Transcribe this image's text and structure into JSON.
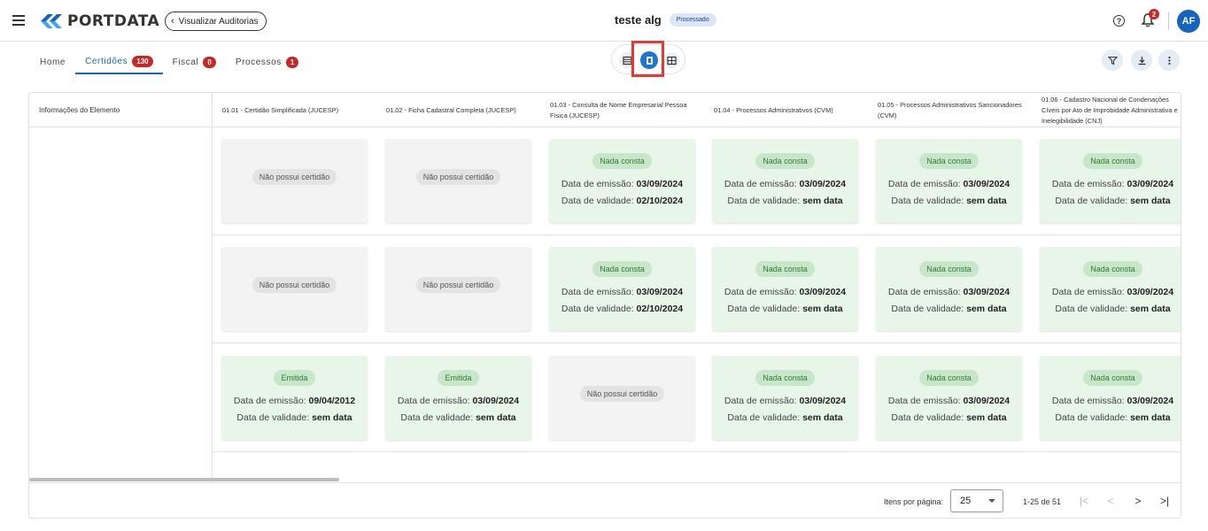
{
  "header": {
    "brand": "PORTDATA",
    "back_label": "Visualizar Auditorias",
    "title": "teste alg",
    "status": "Processado",
    "notif_count": "2",
    "avatar": "AF",
    "help": "?"
  },
  "tabs": [
    {
      "label": "Home",
      "count": null,
      "active": false
    },
    {
      "label": "Certidões",
      "count": "130",
      "active": true
    },
    {
      "label": "Fiscal",
      "count": "0",
      "active": false
    },
    {
      "label": "Processos",
      "count": "1",
      "active": false
    }
  ],
  "view_toggle": {
    "icons": [
      "list-view-icon",
      "card-view-icon",
      "table-view-icon"
    ],
    "active_index": 1
  },
  "actions": [
    "filter-icon",
    "download-icon",
    "more-vert-icon"
  ],
  "table": {
    "left_header": "Informações do Elemento",
    "columns": [
      "01.01 - Certidão Simplificada (JUCESP)",
      "01.02 - Ficha Cadastral Completa (JUCESP)",
      "01.03 - Consulta de Nome Empresarial Pessoa Física (JUCESP)",
      "01.04 - Processos Administrativos (CVM)",
      "01.05 - Processos Administrativos Sancionadores (CVM)",
      "01.06 - Cadastro Nacional de Condenações Cíveis por Ato de Improbidade Administrativa e Inelegibilidade (CNJ)"
    ],
    "labels": {
      "issue": "Data de emissão:",
      "valid": "Data de validade:"
    },
    "rows": [
      [
        {
          "status": "Não possui certidão",
          "type": "none"
        },
        {
          "status": "Não possui certidão",
          "type": "none"
        },
        {
          "status": "Nada consta",
          "type": "ok",
          "issue": "03/09/2024",
          "valid": "02/10/2024"
        },
        {
          "status": "Nada consta",
          "type": "ok",
          "issue": "03/09/2024",
          "valid": "sem data"
        },
        {
          "status": "Nada consta",
          "type": "ok",
          "issue": "03/09/2024",
          "valid": "sem data"
        },
        {
          "status": "Nada consta",
          "type": "ok",
          "issue": "03/09/2024",
          "valid": "sem data"
        }
      ],
      [
        {
          "status": "Não possui certidão",
          "type": "none"
        },
        {
          "status": "Não possui certidão",
          "type": "none"
        },
        {
          "status": "Nada consta",
          "type": "ok",
          "issue": "03/09/2024",
          "valid": "02/10/2024"
        },
        {
          "status": "Nada consta",
          "type": "ok",
          "issue": "03/09/2024",
          "valid": "sem data"
        },
        {
          "status": "Nada consta",
          "type": "ok",
          "issue": "03/09/2024",
          "valid": "sem data"
        },
        {
          "status": "Nada consta",
          "type": "ok",
          "issue": "03/09/2024",
          "valid": "sem data"
        }
      ],
      [
        {
          "status": "Emitida",
          "type": "ok",
          "issue": "09/04/2012",
          "valid": "sem data"
        },
        {
          "status": "Emitida",
          "type": "ok",
          "issue": "03/09/2024",
          "valid": "sem data"
        },
        {
          "status": "Não possui certidão",
          "type": "none"
        },
        {
          "status": "Nada consta",
          "type": "ok",
          "issue": "03/09/2024",
          "valid": "sem data"
        },
        {
          "status": "Nada consta",
          "type": "ok",
          "issue": "03/09/2024",
          "valid": "sem data"
        },
        {
          "status": "Nada consta",
          "type": "ok",
          "issue": "03/09/2024",
          "valid": "sem data"
        }
      ]
    ]
  },
  "pagination": {
    "per_page_label": "Itens por página:",
    "per_page_value": "25",
    "range": "1-25 de 51",
    "first": "|<",
    "prev": "<",
    "next": ">",
    "last": ">|"
  },
  "colors": {
    "accent": "#1565c0",
    "badge_red": "#c62828",
    "ok_bg": "#e8f5e9",
    "none_bg": "#f3f3f3",
    "highlight": "#e53935"
  }
}
